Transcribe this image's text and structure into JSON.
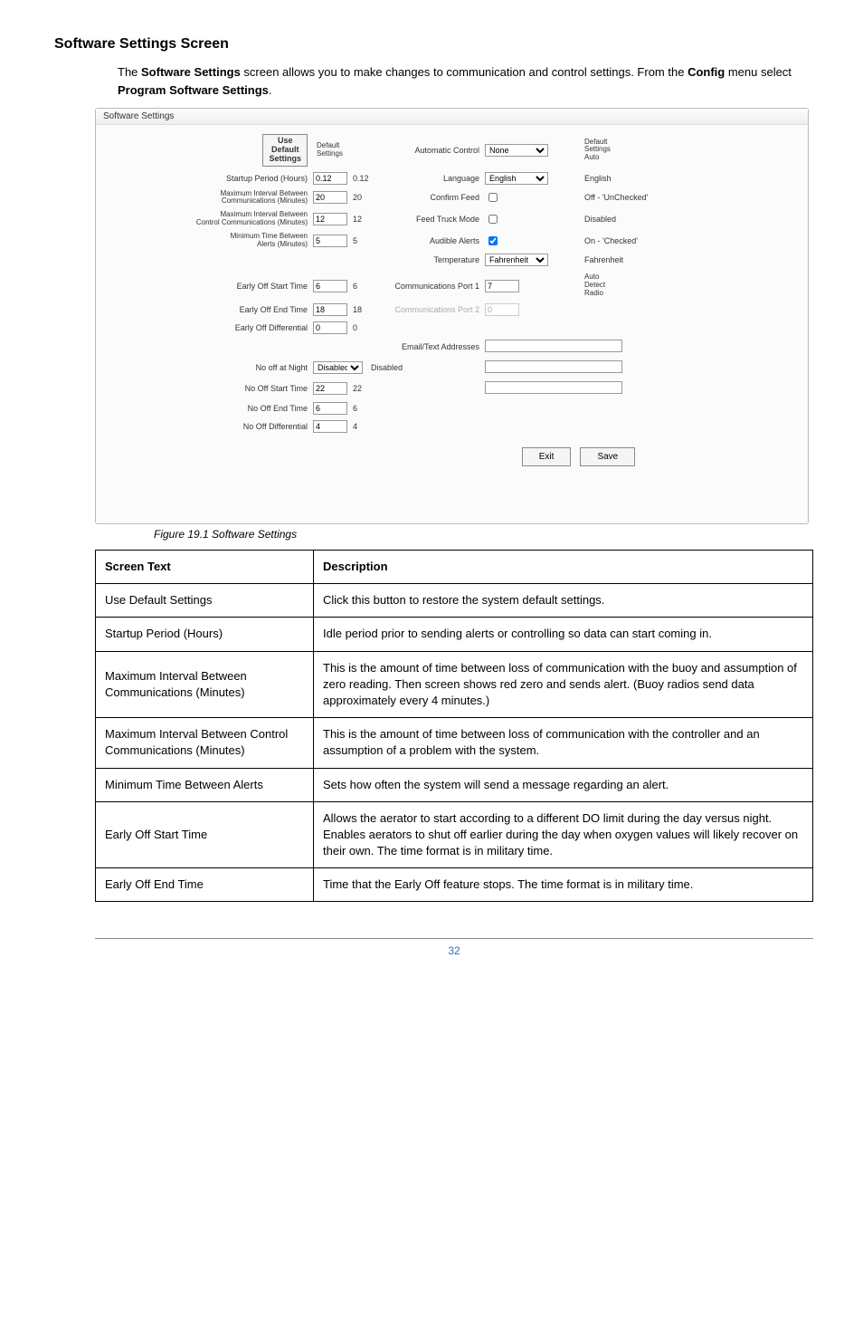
{
  "heading": "Software Settings Screen",
  "intro_parts": {
    "p1": "The ",
    "b1": "Software Settings",
    "p2": " screen allows you to make changes to communication and control settings. From the ",
    "b2": "Config",
    "p3": " menu select ",
    "b3": "Program Software Settings",
    "p4": "."
  },
  "dlg": {
    "title": "Software Settings",
    "use_default_btn": "Use\nDefault\nSettings",
    "default_hdr": "Default\nSettings",
    "default_hdr2": "Default\nSettings",
    "rows": {
      "startup": {
        "lbl": "Startup Period (Hours)",
        "val": "0.12",
        "def": "0.12"
      },
      "max_int": {
        "lbl": "Maximum Interval Between\nCommunications (Minutes)",
        "val": "20",
        "def": "20"
      },
      "max_ctrl": {
        "lbl": "Maximum Interval Between\nControl Communications (Minutes)",
        "val": "12",
        "def": "12"
      },
      "min_alert": {
        "lbl": "Minimum Time Between\nAlerts (Minutes)",
        "val": "5",
        "def": "5"
      },
      "early_start": {
        "lbl": "Early Off Start Time",
        "val": "6",
        "def": "6"
      },
      "early_end": {
        "lbl": "Early Off End Time",
        "val": "18",
        "def": "18"
      },
      "early_diff": {
        "lbl": "Early Off Differential",
        "val": "0",
        "def": "0"
      },
      "no_off_night": {
        "lbl": "No off at Night",
        "val": "Disabled",
        "def": "Disabled"
      },
      "no_off_start": {
        "lbl": "No Off Start Time",
        "val": "22",
        "def": "22"
      },
      "no_off_end": {
        "lbl": "No Off End Time",
        "val": "6",
        "def": "6"
      },
      "no_off_diff": {
        "lbl": "No Off Differential",
        "val": "4",
        "def": "4"
      }
    },
    "right": {
      "auto_ctrl": {
        "lbl": "Automatic Control",
        "val": "None",
        "def": "Auto"
      },
      "lang": {
        "lbl": "Language",
        "val": "English",
        "def": "English"
      },
      "confirm_feed": {
        "lbl": "Confirm Feed",
        "def": "Off - 'UnChecked'"
      },
      "feed_truck": {
        "lbl": "Feed Truck Mode",
        "def": "Disabled"
      },
      "audible": {
        "lbl": "Audible Alerts",
        "def": "On - 'Checked'"
      },
      "temp": {
        "lbl": "Temperature",
        "val": "Fahrenheit",
        "def": "Fahrenheit"
      },
      "port1": {
        "lbl": "Communications Port 1",
        "val": "7",
        "note": "Auto\nDetect\nRadio"
      },
      "port2": {
        "lbl": "Communications Port 2",
        "val": "0"
      },
      "email": {
        "lbl": "Email/Text Addresses"
      }
    },
    "exit": "Exit",
    "save": "Save"
  },
  "figcap": "Figure 19.1 Software Settings",
  "table": {
    "h1": "Screen Text",
    "h2": "Description",
    "rows": [
      {
        "c1": "Use Default Settings",
        "c2": "Click this button to restore the system default settings."
      },
      {
        "c1": "Startup Period (Hours)",
        "c2": "Idle period prior to sending alerts or controlling so data can start coming in."
      },
      {
        "c1": "Maximum Interval Between Communications (Minutes)",
        "c2": "This is the amount of time between loss of communication with the buoy and assumption of zero reading. Then screen shows red zero and sends alert. (Buoy radios send data approximately every 4 minutes.)"
      },
      {
        "c1": "Maximum Interval Between Control Communications (Minutes)",
        "c2": "This is the amount of time between loss of communication with the controller and an assumption of a problem with the system."
      },
      {
        "c1": "Minimum Time Between Alerts",
        "c2": "Sets how often the system will send a message regarding an alert."
      },
      {
        "c1": "Early Off Start Time",
        "c2": "Allows the aerator to start according to a different DO limit during the day versus night. Enables aerators to shut off earlier during the day when oxygen values will likely recover on their own. The time format is in military time."
      },
      {
        "c1": "Early Off End Time",
        "c2": "Time that the Early Off feature stops. The time format is in military time."
      }
    ]
  },
  "page_num": "32"
}
